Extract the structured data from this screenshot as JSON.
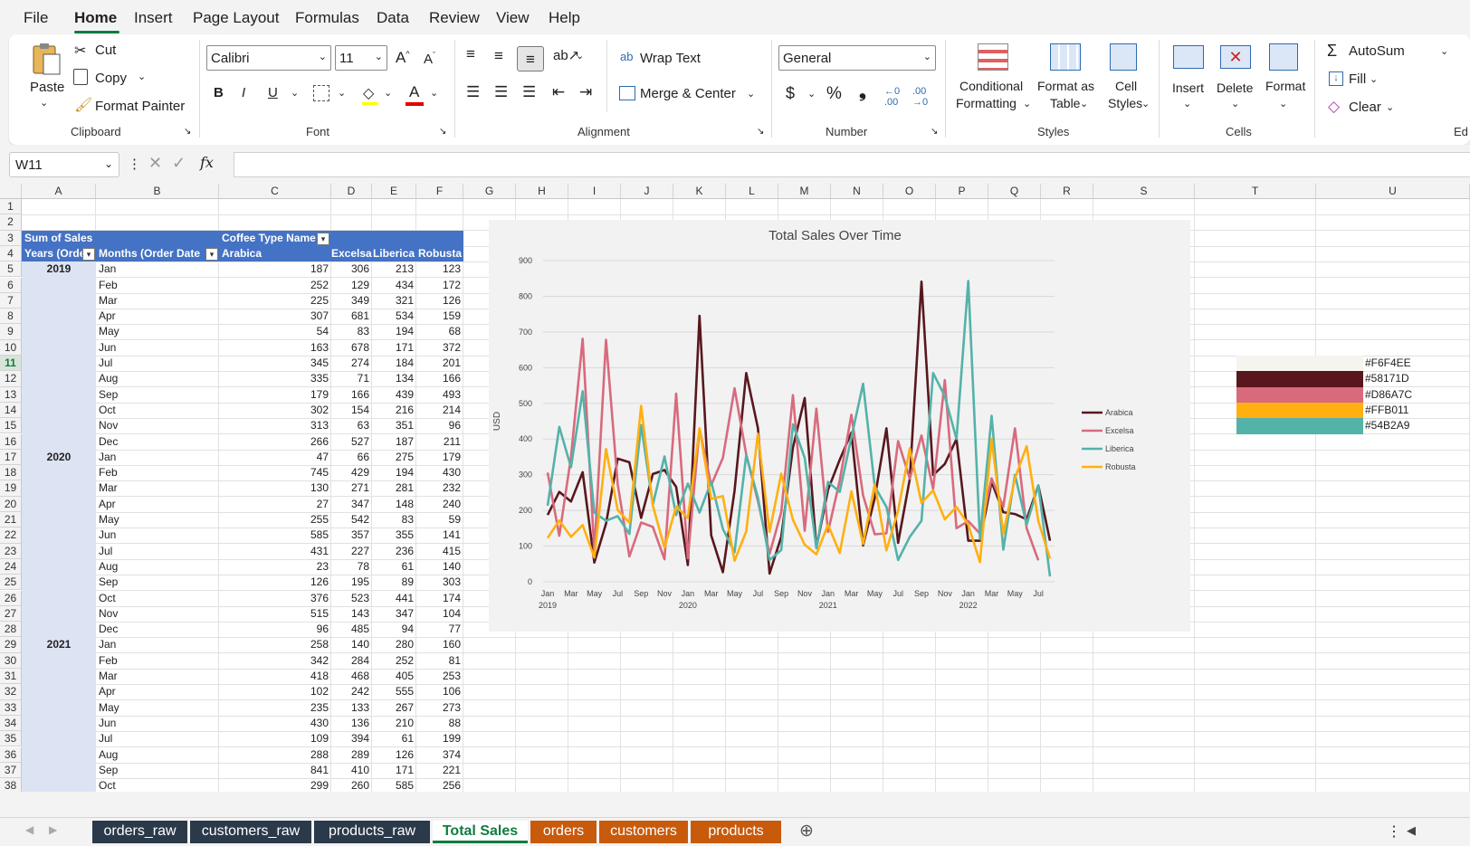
{
  "menu": {
    "items": [
      "File",
      "Home",
      "Insert",
      "Page Layout",
      "Formulas",
      "Data",
      "Review",
      "View",
      "Help"
    ]
  },
  "ribbon": {
    "clipboard": {
      "paste": "Paste",
      "cut": "Cut",
      "copy": "Copy",
      "format_painter": "Format Painter",
      "label": "Clipboard"
    },
    "font": {
      "family": "Calibri",
      "size": "11",
      "label": "Font"
    },
    "alignment": {
      "wrap": "Wrap Text",
      "merge": "Merge & Center",
      "label": "Alignment"
    },
    "number": {
      "format": "General",
      "label": "Number"
    },
    "styles": {
      "cond1": "Conditional",
      "cond2": "Formatting",
      "fmt1": "Format as",
      "fmt2": "Table",
      "cell1": "Cell",
      "cell2": "Styles",
      "label": "Styles"
    },
    "cells": {
      "insert": "Insert",
      "delete": "Delete",
      "format": "Format",
      "label": "Cells"
    },
    "editing": {
      "autosum": "AutoSum",
      "fill": "Fill",
      "clear": "Clear",
      "label": "Ed"
    }
  },
  "formula_bar": {
    "name_box": "W11",
    "fx": "fx",
    "content": ""
  },
  "columns": [
    "A",
    "B",
    "C",
    "D",
    "E",
    "F",
    "G",
    "H",
    "I",
    "J",
    "K",
    "L",
    "M",
    "N",
    "O",
    "P",
    "Q",
    "R",
    "S",
    "T",
    "U"
  ],
  "rows": [
    "1",
    "2",
    "3",
    "4",
    "5",
    "6",
    "7",
    "8",
    "9",
    "10",
    "11",
    "12",
    "13",
    "14",
    "15",
    "16",
    "17",
    "18",
    "19",
    "20",
    "21",
    "22",
    "23",
    "24",
    "25",
    "26",
    "27",
    "28",
    "29",
    "30",
    "31",
    "32",
    "33",
    "34",
    "35",
    "36",
    "37",
    "38"
  ],
  "pivot": {
    "sum_label": "Sum of Sales",
    "coffee_label": "Coffee Type Name",
    "years_label": "Years (Orde",
    "months_label": "Months (Order Date",
    "types": [
      "Arabica",
      "Excelsa",
      "Liberica",
      "Robusta"
    ],
    "rows": [
      {
        "year": "2019",
        "month": "Jan",
        "a": "187",
        "e": "306",
        "l": "213",
        "r": "123"
      },
      {
        "year": "",
        "month": "Feb",
        "a": "252",
        "e": "129",
        "l": "434",
        "r": "172"
      },
      {
        "year": "",
        "month": "Mar",
        "a": "225",
        "e": "349",
        "l": "321",
        "r": "126"
      },
      {
        "year": "",
        "month": "Apr",
        "a": "307",
        "e": "681",
        "l": "534",
        "r": "159"
      },
      {
        "year": "",
        "month": "May",
        "a": "54",
        "e": "83",
        "l": "194",
        "r": "68"
      },
      {
        "year": "",
        "month": "Jun",
        "a": "163",
        "e": "678",
        "l": "171",
        "r": "372"
      },
      {
        "year": "",
        "month": "Jul",
        "a": "345",
        "e": "274",
        "l": "184",
        "r": "201"
      },
      {
        "year": "",
        "month": "Aug",
        "a": "335",
        "e": "71",
        "l": "134",
        "r": "166"
      },
      {
        "year": "",
        "month": "Sep",
        "a": "179",
        "e": "166",
        "l": "439",
        "r": "493"
      },
      {
        "year": "",
        "month": "Oct",
        "a": "302",
        "e": "154",
        "l": "216",
        "r": "214"
      },
      {
        "year": "",
        "month": "Nov",
        "a": "313",
        "e": "63",
        "l": "351",
        "r": "96"
      },
      {
        "year": "",
        "month": "Dec",
        "a": "266",
        "e": "527",
        "l": "187",
        "r": "211"
      },
      {
        "year": "2020",
        "month": "Jan",
        "a": "47",
        "e": "66",
        "l": "275",
        "r": "179"
      },
      {
        "year": "",
        "month": "Feb",
        "a": "745",
        "e": "429",
        "l": "194",
        "r": "430"
      },
      {
        "year": "",
        "month": "Mar",
        "a": "130",
        "e": "271",
        "l": "281",
        "r": "232"
      },
      {
        "year": "",
        "month": "Apr",
        "a": "27",
        "e": "347",
        "l": "148",
        "r": "240"
      },
      {
        "year": "",
        "month": "May",
        "a": "255",
        "e": "542",
        "l": "83",
        "r": "59"
      },
      {
        "year": "",
        "month": "Jun",
        "a": "585",
        "e": "357",
        "l": "355",
        "r": "141"
      },
      {
        "year": "",
        "month": "Jul",
        "a": "431",
        "e": "227",
        "l": "236",
        "r": "415"
      },
      {
        "year": "",
        "month": "Aug",
        "a": "23",
        "e": "78",
        "l": "61",
        "r": "140"
      },
      {
        "year": "",
        "month": "Sep",
        "a": "126",
        "e": "195",
        "l": "89",
        "r": "303"
      },
      {
        "year": "",
        "month": "Oct",
        "a": "376",
        "e": "523",
        "l": "441",
        "r": "174"
      },
      {
        "year": "",
        "month": "Nov",
        "a": "515",
        "e": "143",
        "l": "347",
        "r": "104"
      },
      {
        "year": "",
        "month": "Dec",
        "a": "96",
        "e": "485",
        "l": "94",
        "r": "77"
      },
      {
        "year": "2021",
        "month": "Jan",
        "a": "258",
        "e": "140",
        "l": "280",
        "r": "160"
      },
      {
        "year": "",
        "month": "Feb",
        "a": "342",
        "e": "284",
        "l": "252",
        "r": "81"
      },
      {
        "year": "",
        "month": "Mar",
        "a": "418",
        "e": "468",
        "l": "405",
        "r": "253"
      },
      {
        "year": "",
        "month": "Apr",
        "a": "102",
        "e": "242",
        "l": "555",
        "r": "106"
      },
      {
        "year": "",
        "month": "May",
        "a": "235",
        "e": "133",
        "l": "267",
        "r": "273"
      },
      {
        "year": "",
        "month": "Jun",
        "a": "430",
        "e": "136",
        "l": "210",
        "r": "88"
      },
      {
        "year": "",
        "month": "Jul",
        "a": "109",
        "e": "394",
        "l": "61",
        "r": "199"
      },
      {
        "year": "",
        "month": "Aug",
        "a": "288",
        "e": "289",
        "l": "126",
        "r": "374"
      },
      {
        "year": "",
        "month": "Sep",
        "a": "841",
        "e": "410",
        "l": "171",
        "r": "221"
      },
      {
        "year": "",
        "month": "Oct",
        "a": "299",
        "e": "260",
        "l": "585",
        "r": "256"
      }
    ]
  },
  "palette": [
    {
      "hex": "#F6F4EE",
      "color": "#F6F4EE"
    },
    {
      "hex": "#58171D",
      "color": "#58171D"
    },
    {
      "hex": "#D86A7C",
      "color": "#D86A7C"
    },
    {
      "hex": "#FFB011",
      "color": "#FFB011"
    },
    {
      "hex": "#54B2A9",
      "color": "#54B2A9"
    }
  ],
  "chart_data": {
    "type": "line",
    "title": "Total Sales Over Time",
    "ylabel": "USD",
    "xlabel": "",
    "ylim": [
      0,
      900
    ],
    "yticks": [
      "0",
      "100",
      "200",
      "300",
      "400",
      "500",
      "600",
      "700",
      "800",
      "900"
    ],
    "x_tick_labels": [
      "Jan",
      "Mar",
      "May",
      "Jul",
      "Sep",
      "Nov",
      "Jan",
      "Mar",
      "May",
      "Jul",
      "Sep",
      "Nov",
      "Jan",
      "Mar",
      "May",
      "Jul",
      "Sep",
      "Nov",
      "Jan",
      "Mar",
      "May",
      "Jul"
    ],
    "x_year_labels": [
      {
        "label": "2019",
        "index": 0
      },
      {
        "label": "2020",
        "index": 12
      },
      {
        "label": "2021",
        "index": 24
      },
      {
        "label": "2022",
        "index": 36
      }
    ],
    "legend_position": "right",
    "grid": true,
    "series": [
      {
        "name": "Arabica",
        "color": "#58171D",
        "values": [
          187,
          252,
          225,
          307,
          54,
          163,
          345,
          335,
          179,
          302,
          313,
          266,
          47,
          745,
          130,
          27,
          255,
          585,
          431,
          23,
          126,
          376,
          515,
          96,
          258,
          342,
          418,
          102,
          235,
          430,
          109,
          288,
          841,
          299,
          330,
          400,
          115,
          115,
          280,
          195,
          190,
          175,
          270,
          115
        ]
      },
      {
        "name": "Excelsa",
        "color": "#D86A7C",
        "values": [
          306,
          129,
          349,
          681,
          83,
          678,
          274,
          71,
          166,
          154,
          63,
          527,
          66,
          429,
          271,
          347,
          542,
          357,
          227,
          78,
          195,
          523,
          143,
          485,
          140,
          284,
          468,
          242,
          133,
          136,
          394,
          289,
          410,
          260,
          565,
          150,
          170,
          135,
          290,
          210,
          430,
          150,
          60
        ]
      },
      {
        "name": "Liberica",
        "color": "#54B2A9",
        "values": [
          213,
          434,
          321,
          534,
          194,
          171,
          184,
          134,
          439,
          216,
          351,
          187,
          275,
          194,
          281,
          148,
          83,
          355,
          236,
          61,
          89,
          441,
          347,
          94,
          280,
          252,
          405,
          555,
          267,
          210,
          61,
          126,
          171,
          585,
          520,
          400,
          843,
          120,
          465,
          90,
          300,
          160,
          270,
          15
        ]
      },
      {
        "name": "Robusta",
        "color": "#FFB011",
        "values": [
          123,
          172,
          126,
          159,
          68,
          372,
          201,
          166,
          493,
          214,
          96,
          211,
          179,
          430,
          232,
          240,
          59,
          141,
          415,
          140,
          303,
          174,
          104,
          77,
          160,
          81,
          253,
          106,
          273,
          88,
          199,
          374,
          221,
          256,
          175,
          210,
          160,
          55,
          400,
          135,
          290,
          380,
          170,
          65
        ]
      }
    ]
  },
  "sheets": [
    {
      "name": "orders_raw",
      "color": "#2b3a4a"
    },
    {
      "name": "customers_raw",
      "color": "#2b3a4a"
    },
    {
      "name": "products_raw",
      "color": "#2b3a4a"
    },
    {
      "name": "Total Sales",
      "color": "#ffffff"
    },
    {
      "name": "orders",
      "color": "#c85a0c"
    },
    {
      "name": "customers",
      "color": "#c85a0c"
    },
    {
      "name": "products",
      "color": "#c85a0c"
    }
  ]
}
